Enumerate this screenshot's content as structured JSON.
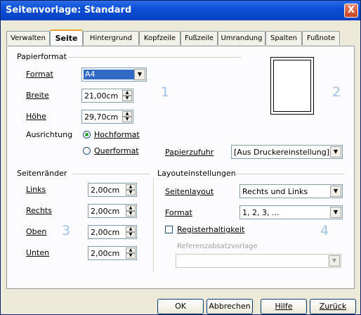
{
  "window": {
    "title": "Seitenvorlage: Standard",
    "close_glyph": "X"
  },
  "tabs": [
    {
      "label": "Verwalten",
      "active": false
    },
    {
      "label": "Seite",
      "active": true
    },
    {
      "label": "Hintergrund",
      "active": false
    },
    {
      "label": "Kopfzeile",
      "active": false
    },
    {
      "label": "Fußzeile",
      "active": false
    },
    {
      "label": "Umrandung",
      "active": false
    },
    {
      "label": "Spalten",
      "active": false
    },
    {
      "label": "Fußnote",
      "active": false
    }
  ],
  "papierformat": {
    "section_title": "Papierformat",
    "format_label": "Format",
    "format_value": "A4",
    "breite_label": "Breite",
    "breite_value": "21,00cm",
    "hoehe_label": "Höhe",
    "hoehe_value": "29,70cm",
    "ausrichtung_label": "Ausrichtung",
    "hochformat_label": "Hochformat",
    "querformat_label": "Querformat",
    "papierzufuhr_label": "Papierzufuhr",
    "papierzufuhr_value": "[Aus Druckereinstellung]"
  },
  "seitenraender": {
    "section_title": "Seitenränder",
    "links_label": "Links",
    "links_value": "2,00cm",
    "rechts_label": "Rechts",
    "rechts_value": "2,00cm",
    "oben_label": "Oben",
    "oben_value": "2,00cm",
    "unten_label": "Unten",
    "unten_value": "2,00cm"
  },
  "layout": {
    "section_title": "Layouteinstellungen",
    "seitenlayout_label": "Seitenlayout",
    "seitenlayout_value": "Rechts und Links",
    "format_label": "Format",
    "format_value": "1, 2, 3, ...",
    "registerhaltigkeit_label": "Registerhaltigkeit",
    "referenz_label": "Referenzabsatzvorlage",
    "referenz_value": ""
  },
  "markers": {
    "one": "1",
    "two": "2",
    "three": "3",
    "four": "4"
  },
  "buttons": {
    "ok": "OK",
    "abbrechen": "Abbrechen",
    "hilfe": "Hilfe",
    "zurueck": "Zurück"
  },
  "colors": {
    "title_bar": "#0b4fd6",
    "marker": "#9ec3ea",
    "radio_dot": "#21a121"
  }
}
